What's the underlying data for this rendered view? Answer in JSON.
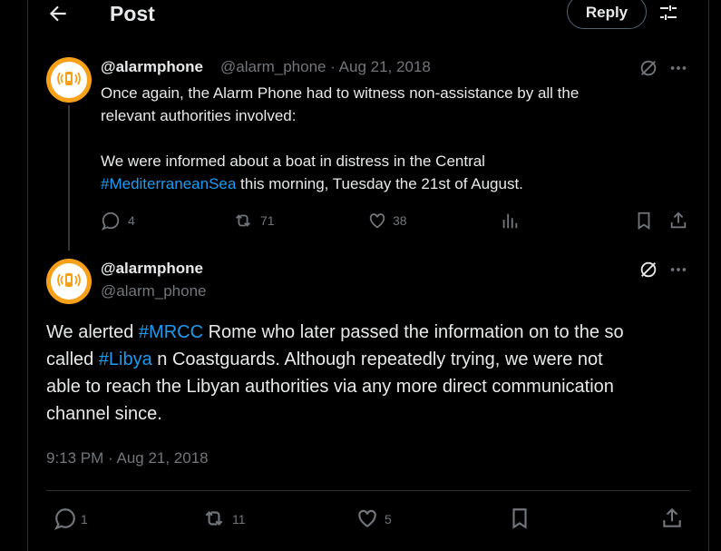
{
  "header": {
    "title": "Post",
    "reply_label": "Reply"
  },
  "parent_post": {
    "name": "@alarmphone",
    "meta": "@alarm_phone · Aug 21, 2018",
    "line1": "Once again, the Alarm Phone had to witness non-assistance by all the",
    "line2": "relevant authorities involved:",
    "line3": "We were informed about a boat in distress in the Central",
    "hashtag": "#MediterraneanSea",
    "line4_rest": " this morning, Tuesday the 21st of August.",
    "stats": {
      "replies": "4",
      "reposts": "71",
      "likes": "38"
    }
  },
  "main_post": {
    "name": "@alarmphone",
    "handle": "@alarm_phone",
    "l1_a": "We alerted ",
    "l1_tag": "#MRCC",
    "l1_b": " Rome who later passed the information on to the so",
    "l2_a": "called ",
    "l2_tag": "#Libya",
    "l2_b": " n Coastguards. Although repeatedly trying, we were not",
    "l3": "able to reach the Libyan authorities via any more direct communication",
    "l4": "channel since.",
    "timestamp": "9:13 PM · Aug 21, 2018",
    "stats": {
      "replies": "1",
      "reposts": "11",
      "likes": "5"
    }
  },
  "colors": {
    "accent": "#1d9bf0",
    "avatar_orange": "#f7a01a",
    "muted": "#71767b"
  }
}
